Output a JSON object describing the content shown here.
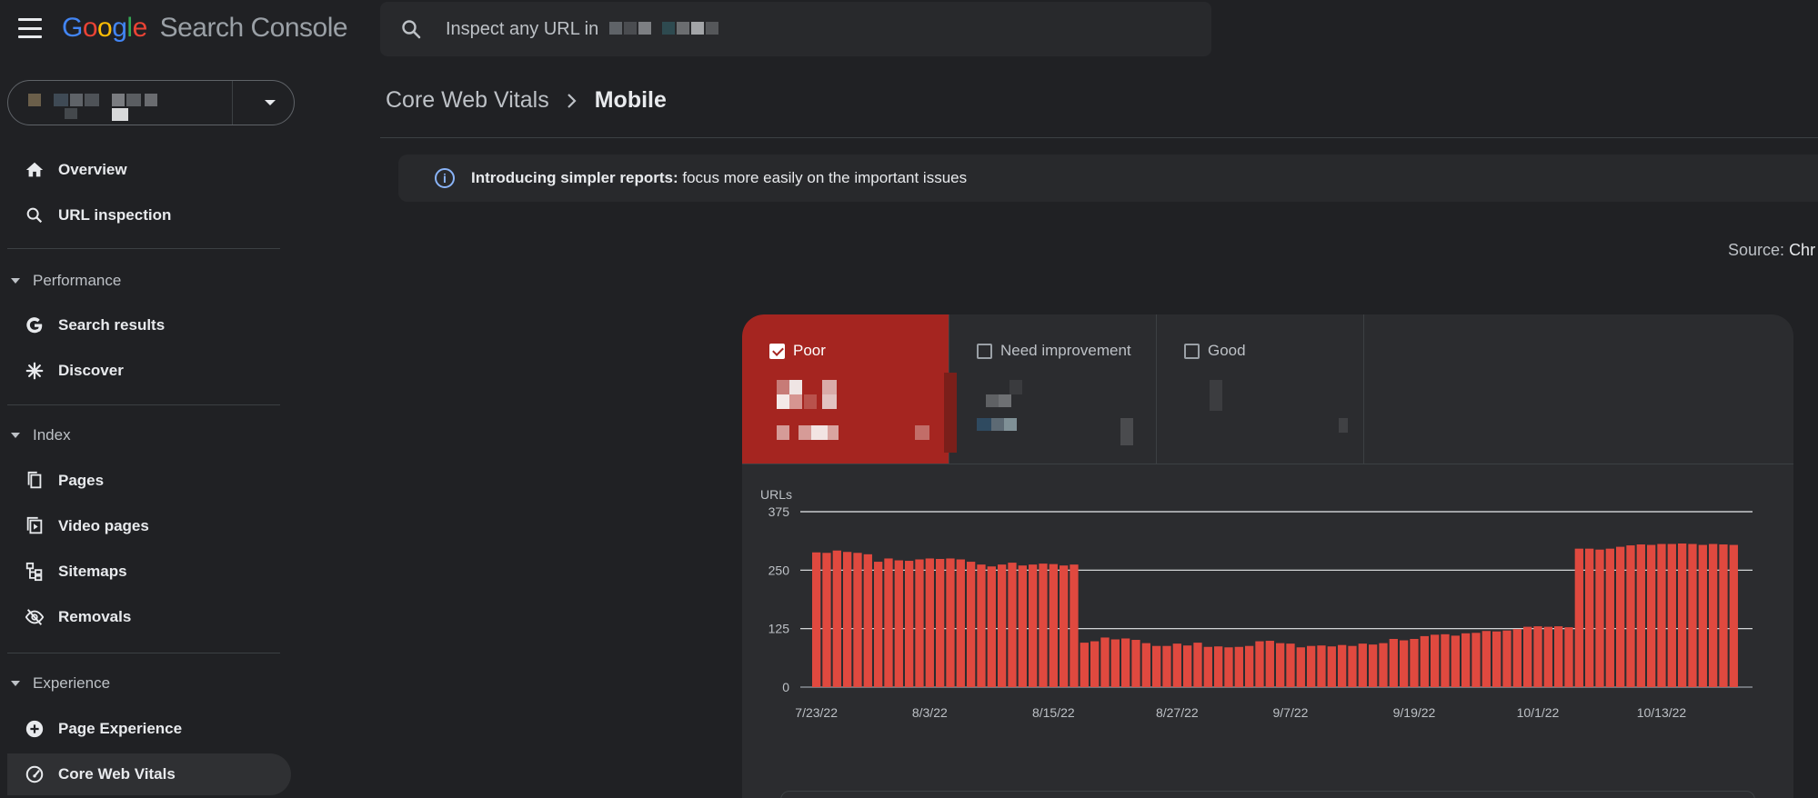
{
  "app": {
    "logo_letters": [
      "G",
      "o",
      "o",
      "g",
      "l",
      "e"
    ],
    "product": "Search Console",
    "menu_icon": "menu-icon"
  },
  "search": {
    "placeholder": "Inspect any URL in",
    "icon": "search-icon"
  },
  "sidebar": {
    "nav": [
      {
        "label": "Overview",
        "icon": "home-icon"
      },
      {
        "label": "URL inspection",
        "icon": "search-icon"
      }
    ],
    "sections": [
      {
        "title": "Performance",
        "items": [
          {
            "label": "Search results",
            "icon": "google-g-icon"
          },
          {
            "label": "Discover",
            "icon": "asterisk-icon"
          }
        ]
      },
      {
        "title": "Index",
        "items": [
          {
            "label": "Pages",
            "icon": "pages-icon"
          },
          {
            "label": "Video pages",
            "icon": "video-pages-icon"
          },
          {
            "label": "Sitemaps",
            "icon": "sitemap-icon"
          },
          {
            "label": "Removals",
            "icon": "eye-off-icon"
          }
        ]
      },
      {
        "title": "Experience",
        "items": [
          {
            "label": "Page Experience",
            "icon": "plus-circle-icon"
          },
          {
            "label": "Core Web Vitals",
            "icon": "gauge-icon",
            "active": true
          }
        ]
      }
    ]
  },
  "breadcrumb": {
    "parent": "Core Web Vitals",
    "current": "Mobile"
  },
  "banner": {
    "bold": "Introducing simpler reports:",
    "text": " focus more easily on the important issues"
  },
  "source": {
    "label": "Source:",
    "value": "Chr"
  },
  "tabs": [
    {
      "label": "Poor",
      "checked": true
    },
    {
      "label": "Need improvement",
      "checked": false
    },
    {
      "label": "Good",
      "checked": false
    }
  ],
  "colors": {
    "poor": "#a52520",
    "bar": "#e0493f",
    "grid": "#e8eaed",
    "accent_blue": "#8ab4f8"
  },
  "chart_data": {
    "type": "bar",
    "ylabel": "URLs",
    "ylim": [
      0,
      375
    ],
    "yticks": [
      0,
      125,
      250,
      375
    ],
    "xtick_labels": [
      "7/23/22",
      "8/3/22",
      "8/15/22",
      "8/27/22",
      "9/7/22",
      "9/19/22",
      "10/1/22",
      "10/13/22"
    ],
    "xtick_indices": [
      0,
      11,
      23,
      35,
      46,
      58,
      70,
      82
    ],
    "series": [
      {
        "values": [
          288,
          287,
          292,
          289,
          287,
          284,
          268,
          275,
          271,
          270,
          273,
          275,
          274,
          275,
          273,
          268,
          262,
          258,
          262,
          266,
          260,
          262,
          264,
          263,
          260,
          262,
          95,
          98,
          106,
          102,
          104,
          101,
          94,
          88,
          88,
          93,
          89,
          95,
          86,
          87,
          85,
          86,
          88,
          98,
          99,
          94,
          93,
          85,
          88,
          89,
          87,
          90,
          88,
          93,
          91,
          94,
          103,
          100,
          103,
          109,
          112,
          113,
          110,
          115,
          116,
          120,
          119,
          121,
          124,
          129,
          130,
          129,
          130,
          128,
          296,
          296,
          294,
          296,
          300,
          303,
          305,
          304,
          306,
          306,
          307,
          306,
          304,
          306,
          305,
          304
        ]
      }
    ]
  }
}
